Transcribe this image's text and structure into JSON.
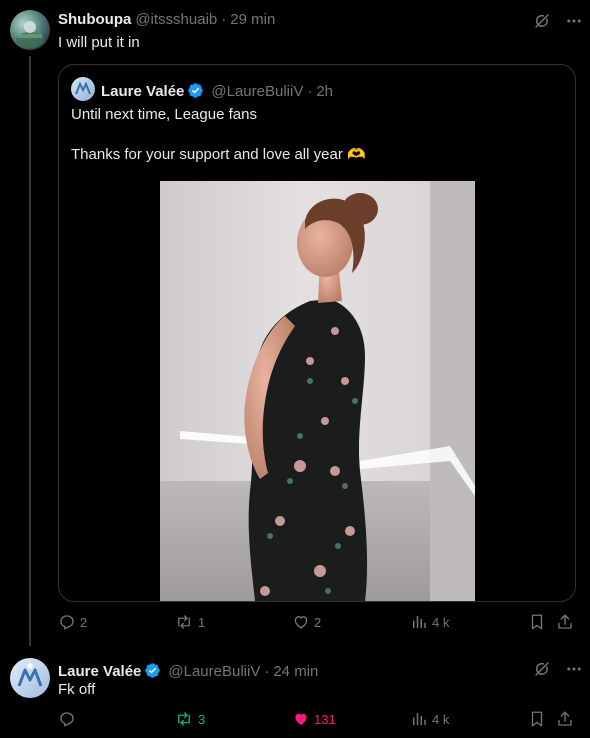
{
  "reply1": {
    "name": "Shuboupa",
    "handle": "@itssshuaib",
    "dot": "·",
    "time": "29 min",
    "text": "I will put it in",
    "quoted": {
      "name": "Laure Valée",
      "handle": "@LaureBuliiV",
      "dot": "·",
      "time": "2h",
      "line1": "Until next time, League fans",
      "line2": "Thanks for your support and love all year 🫶"
    },
    "actions": {
      "replies": "2",
      "reposts": "1",
      "likes": "2",
      "views": "4 k"
    }
  },
  "reply2": {
    "name": "Laure Valée",
    "handle": "@LaureBuliiV",
    "dot": "·",
    "time": "24 min",
    "text": "Fk off",
    "actions": {
      "replies": "",
      "reposts": "3",
      "likes": "131",
      "views": "4 k"
    }
  },
  "icons": {
    "grok": "grok-icon",
    "more": "more-icon",
    "reply": "reply-icon",
    "repost": "repost-icon",
    "like": "heart-icon",
    "views": "views-icon",
    "bookmark": "bookmark-icon",
    "share": "share-icon"
  },
  "colors": {
    "background": "#000000",
    "text": "#e7e9ea",
    "muted": "#71767b",
    "verified": "#1d9bf0",
    "repost_active": "#00ba7c",
    "like_active": "#f91880",
    "border": "#2f3336"
  }
}
